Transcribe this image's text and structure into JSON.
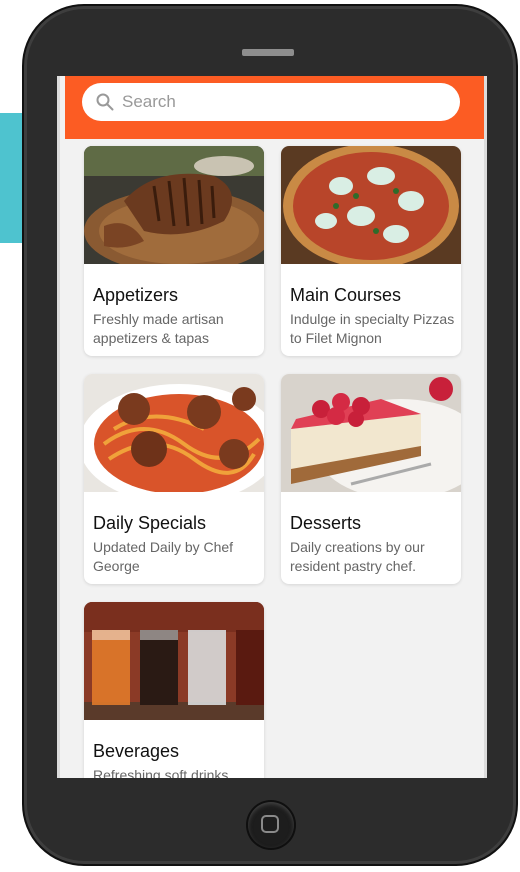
{
  "search": {
    "placeholder": "Search"
  },
  "categories": [
    {
      "title": "Appetizers",
      "description": "Freshly made artisan appetizers & tapas"
    },
    {
      "title": "Main Courses",
      "description": "Indulge in specialty Pizzas to Filet Mignon"
    },
    {
      "title": "Daily Specials",
      "description": "Updated Daily by Chef George"
    },
    {
      "title": "Desserts",
      "description": "Daily creations by our resident pastry chef."
    },
    {
      "title": "Beverages",
      "description": "Refreshing soft drinks"
    }
  ],
  "colors": {
    "header": "#fc5c23",
    "accent": "#4ec3cf"
  }
}
